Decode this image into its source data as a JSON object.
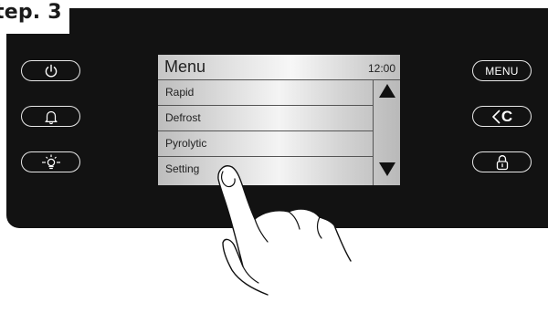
{
  "step": {
    "label": "tep. 3"
  },
  "left_buttons": [
    {
      "name": "power-button",
      "icon": "power-icon"
    },
    {
      "name": "alarm-button",
      "icon": "bell-icon"
    },
    {
      "name": "light-button",
      "icon": "oven-light-icon"
    }
  ],
  "right_buttons": {
    "menu_label": "MENU",
    "back_label": "C",
    "lock_icon": "lock-icon"
  },
  "screen": {
    "title": "Menu",
    "clock": "12:00",
    "items": [
      {
        "label": "Rapid"
      },
      {
        "label": "Defrost"
      },
      {
        "label": "Pyrolytic"
      },
      {
        "label": "Setting"
      }
    ],
    "scroll_up_icon": "triangle-up-icon",
    "scroll_down_icon": "triangle-down-icon",
    "selected_item": "Setting"
  },
  "colors": {
    "panel": "#121212",
    "button_outline": "#e8e8e8",
    "screen_text": "#222222"
  }
}
